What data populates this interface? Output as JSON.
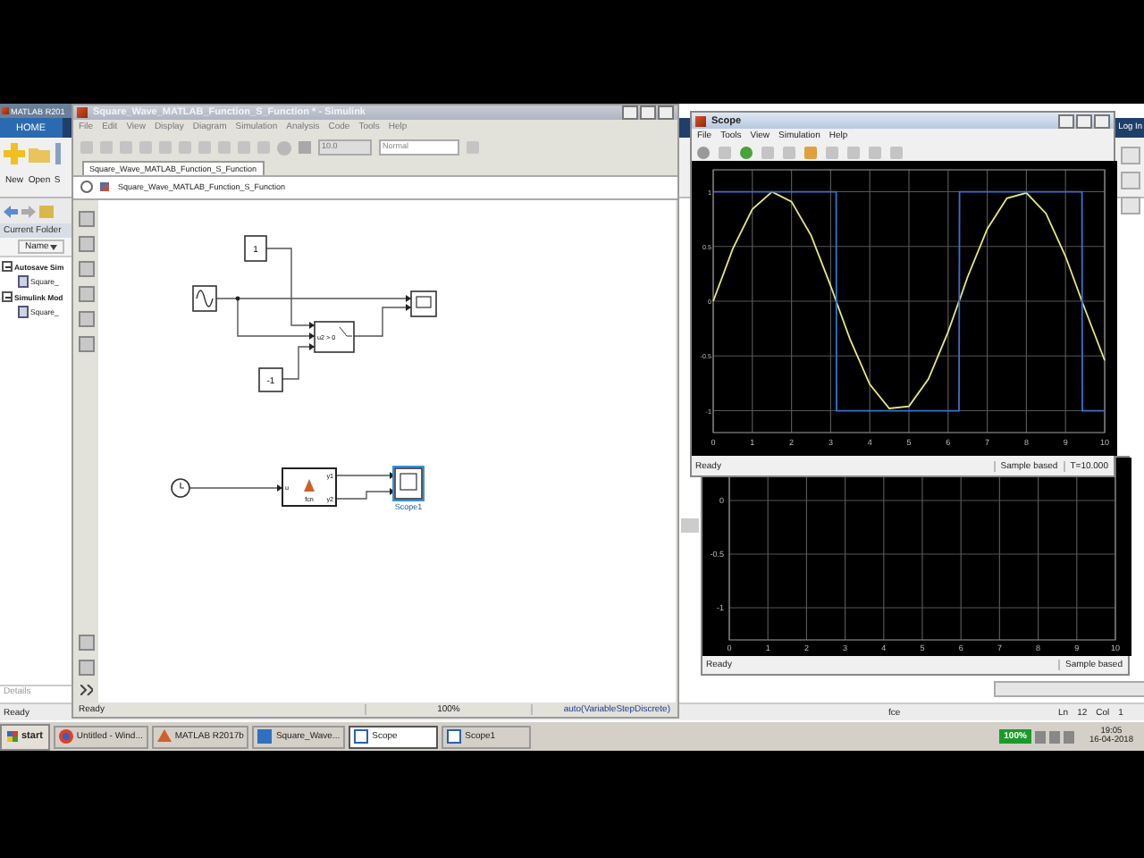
{
  "matlab": {
    "title": "MATLAB R201",
    "tab": "HOME",
    "tools": [
      "New",
      "Open",
      "S"
    ],
    "login": "Log In",
    "current_folder": {
      "title": "Current Folder",
      "column": "Name",
      "tree": [
        {
          "label": "Autosave Sim",
          "expanded": true,
          "children": [
            {
              "label": "Square_"
            }
          ]
        },
        {
          "label": "Simulink Mod",
          "expanded": true,
          "children": [
            {
              "label": "Square_"
            }
          ]
        }
      ],
      "details": "Details"
    },
    "status": "Ready",
    "editor_status": {
      "encoding": "fce",
      "line_label": "Ln",
      "line": "12",
      "col_label": "Col",
      "col": "1"
    }
  },
  "simulink": {
    "title": "Square_Wave_MATLAB_Function_S_Function * - Simulink",
    "menu": [
      "File",
      "Edit",
      "View",
      "Display",
      "Diagram",
      "Simulation",
      "Analysis",
      "Code",
      "Tools",
      "Help"
    ],
    "stop_time": "10.0",
    "mode": "Normal",
    "tab": "Square_Wave_MATLAB_Function_S_Function",
    "address": "Square_Wave_MATLAB_Function_S_Function",
    "blocks": [
      {
        "kind": "constant",
        "label": "1",
        "selected": false
      },
      {
        "kind": "sine",
        "selected": false
      },
      {
        "kind": "scope",
        "selected": false
      },
      {
        "kind": "switch",
        "label": "u2 > 0",
        "selected": false
      },
      {
        "kind": "constant",
        "label": "-1",
        "selected": false
      },
      {
        "kind": "clock",
        "selected": false
      },
      {
        "kind": "function",
        "label": "fcn",
        "inputs": [
          "u"
        ],
        "outputs": [
          "y1",
          "y2"
        ],
        "selected": false
      },
      {
        "kind": "scope",
        "label": "Scope1",
        "selected": true
      }
    ],
    "status": {
      "state": "Ready",
      "zoom": "100%",
      "solver": "auto(VariableStepDiscrete)"
    }
  },
  "scope": {
    "title": "Scope",
    "menu": [
      "File",
      "Tools",
      "View",
      "Simulation",
      "Help"
    ],
    "chart_data": {
      "type": "line",
      "grid": true,
      "xlim": [
        0,
        10
      ],
      "ylim": [
        -1.2,
        1.2
      ],
      "xticks": [
        0,
        1,
        2,
        3,
        4,
        5,
        6,
        7,
        8,
        9,
        10
      ],
      "yticks": [
        -1,
        -0.5,
        0,
        0.5,
        1
      ],
      "x": [
        0,
        0.5,
        1,
        1.5,
        2,
        2.5,
        3,
        3.14,
        3.15,
        3.5,
        4,
        4.5,
        5,
        5.5,
        6,
        6.28,
        6.29,
        6.5,
        7,
        7.5,
        8,
        8.5,
        9,
        9.42,
        9.43,
        10
      ],
      "series": [
        {
          "color": "#e8e87a",
          "values": [
            0,
            0.48,
            0.84,
            1,
            0.91,
            0.6,
            0.14,
            0,
            -0.01,
            -0.35,
            -0.76,
            -0.98,
            -0.96,
            -0.71,
            -0.28,
            0,
            0.01,
            0.22,
            0.66,
            0.94,
            0.99,
            0.8,
            0.41,
            0,
            -0.01,
            -0.54
          ]
        },
        {
          "color": "#3c6fd0",
          "values": [
            1,
            1,
            1,
            1,
            1,
            1,
            1,
            1,
            -1,
            -1,
            -1,
            -1,
            -1,
            -1,
            -1,
            -1,
            1,
            1,
            1,
            1,
            1,
            1,
            1,
            1,
            -1,
            -1
          ]
        }
      ]
    },
    "status": {
      "state": "Ready",
      "mode": "Sample based",
      "time": "T=10.000"
    }
  },
  "scope1": {
    "chart_data": {
      "type": "line",
      "grid": true,
      "xlim": [
        0,
        10
      ],
      "ylim": [
        -1.3,
        0.4
      ],
      "xticks": [
        0,
        1,
        2,
        3,
        4,
        5,
        6,
        7,
        8,
        9,
        10
      ],
      "yticks": [
        -1,
        -0.5,
        0
      ]
    },
    "status": {
      "state": "Ready",
      "mode": "Sample based"
    }
  },
  "taskbar": {
    "start": "start",
    "items": [
      {
        "label": "Untitled - Wind...",
        "kind": "browser",
        "selected": false
      },
      {
        "label": "MATLAB R2017b",
        "kind": "matlab",
        "selected": false
      },
      {
        "label": "Square_Wave...",
        "kind": "simulink",
        "selected": false
      },
      {
        "label": "Scope",
        "kind": "scope",
        "selected": true
      },
      {
        "label": "Scope1",
        "kind": "scope",
        "selected": false
      }
    ],
    "battery": "100%",
    "time": "19:05",
    "date": "16-04-2018"
  }
}
